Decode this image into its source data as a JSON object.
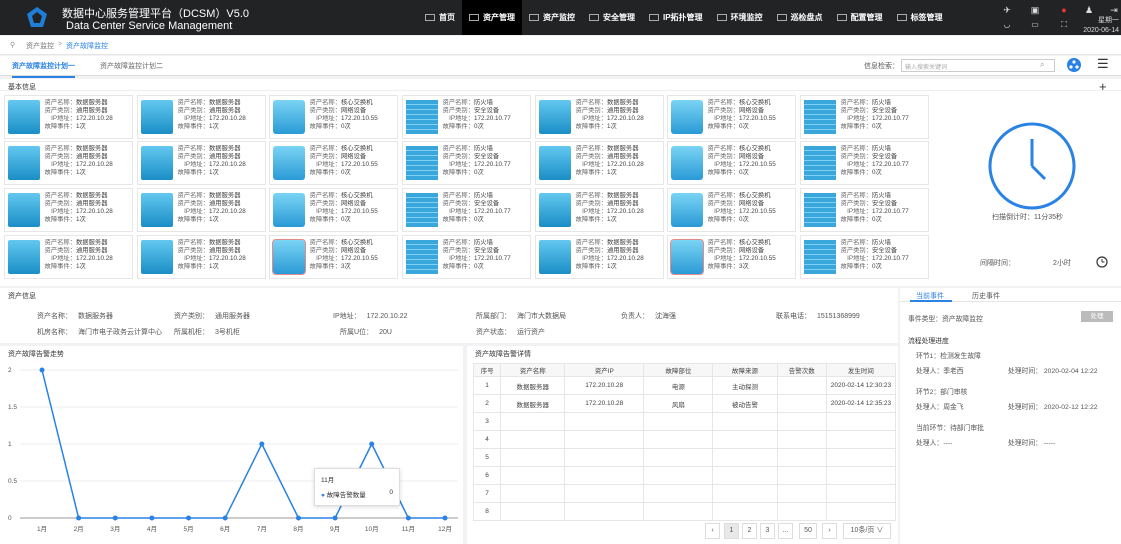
{
  "header": {
    "title_cn": "数据中心服务管理平台（DCSM）V5.0",
    "title_en": "Data Center Service Management",
    "weekday": "星期一",
    "date": "2020-06-14",
    "nav": [
      "首页",
      "资产管理",
      "资产监控",
      "安全管理",
      "IP拓扑管理",
      "环境监控",
      "巡检盘点",
      "配置管理",
      "标签管理"
    ]
  },
  "breadcrumb": {
    "root": "资产监控",
    "sep": ">",
    "current": "资产故障监控"
  },
  "tabs": [
    "资产故障监控计划一",
    "资产故障监控计划二"
  ],
  "search": {
    "label": "信息检索：",
    "placeholder": "输入搜索关键词"
  },
  "basic": {
    "title": "基本信息",
    "labels": {
      "name": "资产名称：",
      "type": "资产类别：",
      "ip": "IP地址：",
      "faults": "故障事件："
    },
    "server": {
      "name": "数据服务器",
      "type": "通用服务器",
      "ip": "172.20.10.28",
      "faults": "1次"
    },
    "switch": {
      "name": "核心交换机",
      "type": "网络设备",
      "ip": "172.20.10.55",
      "faults": "0次",
      "faults_alt": "3次"
    },
    "firewall": {
      "name": "防火墙",
      "type": "安全设备",
      "ip": "172.20.10.77",
      "faults": "0次"
    }
  },
  "clock": {
    "scan_label": "扫描倒计时：",
    "scan_value": "11分35秒",
    "interval_label": "间隔时间：",
    "interval_value": "2小时"
  },
  "asset_info": {
    "title": "资产信息",
    "name_l": "资产名称：",
    "name": "数据服务器",
    "type_l": "资产类别：",
    "type": "通用服务器",
    "ip_l": "IP地址：",
    "ip": "172.20.10.22",
    "dept_l": "所属部门：",
    "dept": "海门市大数据局",
    "owner_l": "负责人：",
    "owner": "沈海强",
    "phone_l": "联系电话：",
    "phone": "15151368999",
    "room_l": "机房名称：",
    "room": "海门市电子政务云计算中心",
    "rack_l": "所属机柜：",
    "rack": "3号机柜",
    "pos_l": "所属U位：",
    "pos": "20U",
    "status_l": "资产状态：",
    "status": "运行资产"
  },
  "trend": {
    "title": "资产故障告警走势",
    "tooltip_month": "11月",
    "tooltip_label": "故障告警数量",
    "tooltip_value": "0"
  },
  "chart_data": {
    "type": "line",
    "categories": [
      "1月",
      "2月",
      "3月",
      "4月",
      "5月",
      "6月",
      "7月",
      "8月",
      "9月",
      "10月",
      "11月",
      "12月"
    ],
    "series": [
      {
        "name": "故障告警数量",
        "values": [
          2,
          0,
          0,
          0,
          0,
          0,
          1,
          0,
          0,
          1,
          0,
          0
        ]
      }
    ],
    "yticks": [
      "0",
      "0.5",
      "1",
      "1.5",
      "2"
    ],
    "ylim": [
      0,
      2
    ]
  },
  "detail": {
    "title": "资产故障告警详情",
    "headers": [
      "序号",
      "资产名称",
      "资产IP",
      "故障部位",
      "故障来源",
      "告警次数",
      "发生时间"
    ],
    "rows": [
      [
        "1",
        "数据服务器",
        "172.20.10.28",
        "电源",
        "主动探测",
        "",
        "2020-02-14 12:30:23"
      ],
      [
        "2",
        "数据服务器",
        "172.20.10.28",
        "风扇",
        "被动告警",
        "",
        "2020-02-14 12:35:23"
      ],
      [
        "3",
        "",
        "",
        "",
        "",
        "",
        ""
      ],
      [
        "4",
        "",
        "",
        "",
        "",
        "",
        ""
      ],
      [
        "5",
        "",
        "",
        "",
        "",
        "",
        ""
      ],
      [
        "6",
        "",
        "",
        "",
        "",
        "",
        ""
      ],
      [
        "7",
        "",
        "",
        "",
        "",
        "",
        ""
      ],
      [
        "8",
        "",
        "",
        "",
        "",
        "",
        ""
      ]
    ],
    "pager": [
      "‹",
      "1",
      "2",
      "3",
      "...",
      "50",
      "›"
    ],
    "page_size": "10条/页 ∨"
  },
  "events": {
    "tab_current": "当前事件",
    "tab_history": "历史事件",
    "type_l": "事件类型：",
    "type": "资产故障监控",
    "handle": "处理",
    "flow_title": "流程处理进度",
    "steps": [
      {
        "a": "环节1：",
        "b": "检测发生故障",
        "c": "处理人：",
        "d": "季老西",
        "e": "处理时间：",
        "f": "2020-02-04 12:22"
      },
      {
        "a": "环节2：",
        "b": "部门审核",
        "c": "处理人：",
        "d": "周金飞",
        "e": "处理时间：",
        "f": "2020-02-12 12:22"
      },
      {
        "a": "当前环节：",
        "b": "待部门审批",
        "c": "处理人：",
        "d": "----",
        "e": "处理时间：",
        "f": "-----"
      }
    ]
  }
}
